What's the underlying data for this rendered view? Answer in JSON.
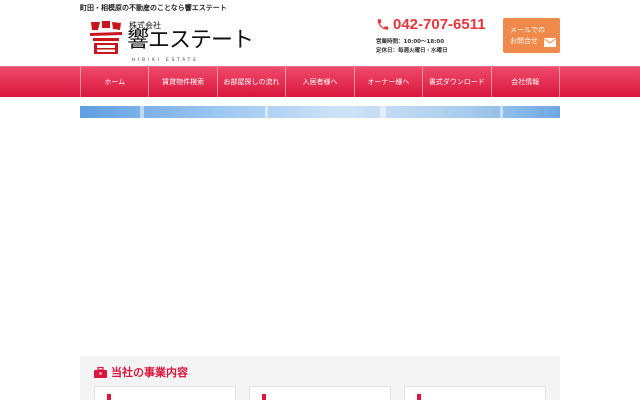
{
  "header": {
    "tagline": "町田・相模原の不動産のことなら響エステート",
    "logo": {
      "company_type": "株式会社",
      "name": "響エステート",
      "romanized": "HIBIKI ESTATE",
      "mark_glyph": "響"
    },
    "phone": {
      "number": "042-707-6511",
      "hours": "営業時間：10:00〜18:00",
      "closed": "定休日：毎週火曜日・水曜日"
    },
    "mail_button": {
      "line1": "メールでの",
      "line2": "お問合せ"
    }
  },
  "nav": {
    "items": [
      {
        "label": "ホーム"
      },
      {
        "label": "賃貸物件検索"
      },
      {
        "label": "お部屋探しの流れ"
      },
      {
        "label": "入居者様へ"
      },
      {
        "label": "オーナー様へ"
      },
      {
        "label": "書式ダウンロード"
      },
      {
        "label": "会社情報"
      }
    ]
  },
  "services": {
    "title": "当社の事業内容"
  },
  "colors": {
    "brand_red": "#d9163d",
    "phone_red": "#e8343c",
    "mail_orange": "#f08a4a"
  }
}
